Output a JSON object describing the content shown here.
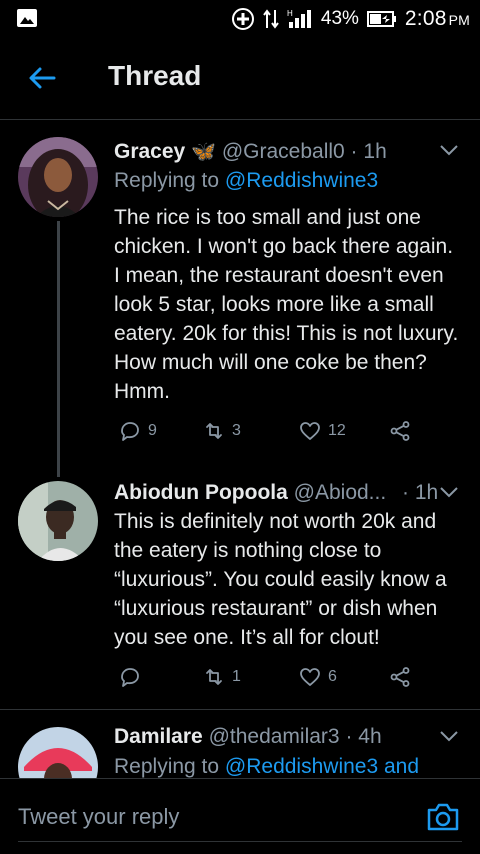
{
  "status_bar": {
    "battery": "43%",
    "time": "2:08",
    "ampm": "PM",
    "icons": [
      "gallery-icon",
      "data-saver-icon",
      "data-transfer-icon",
      "signal-icon",
      "battery-icon"
    ]
  },
  "header": {
    "back_icon": "arrow-left-icon",
    "title": "Thread"
  },
  "tweets": [
    {
      "name": "Gracey",
      "emoji": "🦋",
      "handle": "@Graceball0",
      "sep": "·",
      "time": "1h",
      "reply_prefix": "Replying to",
      "reply_to": "@Reddishwine3",
      "text": "The rice is too small and just one chicken. I won't go back there again. I mean, the restaurant doesn't even look 5 star,  looks more like a small eatery. 20k for this! This is not luxury. How much will one coke be then?  Hmm.",
      "replies": "9",
      "retweets": "3",
      "likes": "12"
    },
    {
      "name": "Abiodun Popoola",
      "handle": "@Abiod...",
      "sep": "·",
      "time": "1h",
      "text": "This is definitely not worth 20k and the eatery is nothing close to “luxurious”. You could easily know a “luxurious restaurant” or dish when you see one. It’s all for clout!",
      "replies": "",
      "retweets": "1",
      "likes": "6"
    },
    {
      "name": "Damilare",
      "handle": "@thedamilar3",
      "sep": "·",
      "time": "4h",
      "reply_prefix": "Replying to",
      "reply_to": "@Reddishwine3 and"
    }
  ],
  "reply_bar": {
    "placeholder": "Tweet your reply",
    "camera_icon": "camera-icon"
  },
  "colors": {
    "background": "#000000",
    "accent": "#1d9bf0",
    "muted": "#8b98a5",
    "text": "#e7e9ea",
    "divider": "#2f3336"
  }
}
